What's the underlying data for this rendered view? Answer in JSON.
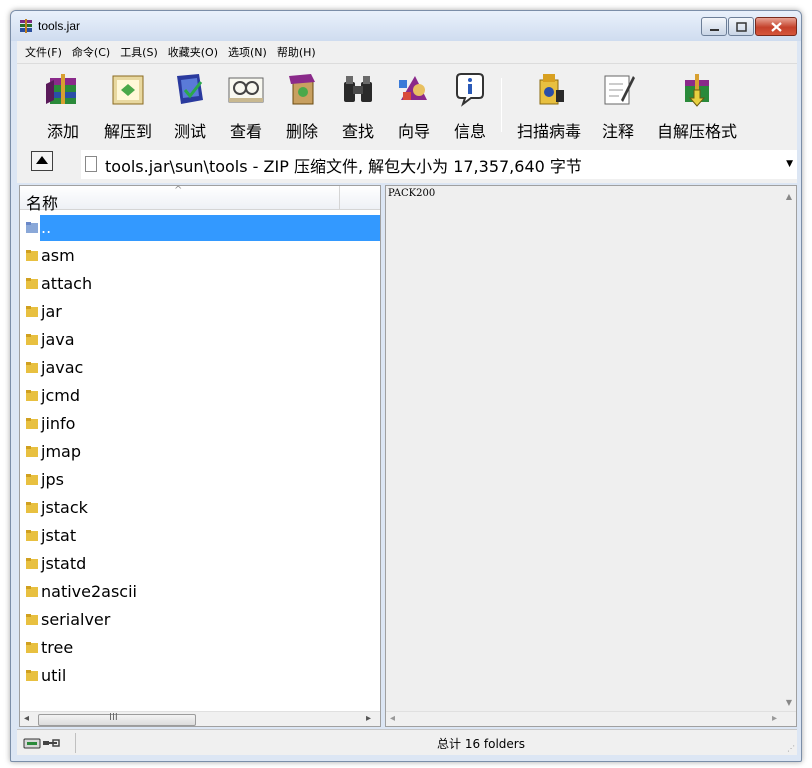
{
  "window": {
    "title": "tools.jar"
  },
  "menu": [
    "文件(F)",
    "命令(C)",
    "工具(S)",
    "收藏夹(O)",
    "选项(N)",
    "帮助(H)"
  ],
  "toolbar": {
    "add": "添加",
    "extract": "解压到",
    "test": "测试",
    "view": "查看",
    "delete": "删除",
    "find": "查找",
    "wizard": "向导",
    "info": "信息",
    "virus_scan": "扫描病毒",
    "comment": "注释",
    "sfx": "自解压格式"
  },
  "address": {
    "text": "tools.jar\\sun\\tools - ZIP 压缩文件, 解包大小为 17,357,640 字节"
  },
  "list": {
    "column_name": "名称",
    "items": [
      "..",
      "asm",
      "attach",
      "jar",
      "java",
      "javac",
      "jcmd",
      "jinfo",
      "jmap",
      "jps",
      "jstack",
      "jstat",
      "jstatd",
      "native2ascii",
      "serialver",
      "tree",
      "util"
    ]
  },
  "comment_pane": {
    "text": "PACK200"
  },
  "hscroll": {
    "grip": "III"
  },
  "status": {
    "summary": "总计 16 folders"
  },
  "colors": {
    "selection": "#3399ff",
    "folder": "#e8c040"
  }
}
